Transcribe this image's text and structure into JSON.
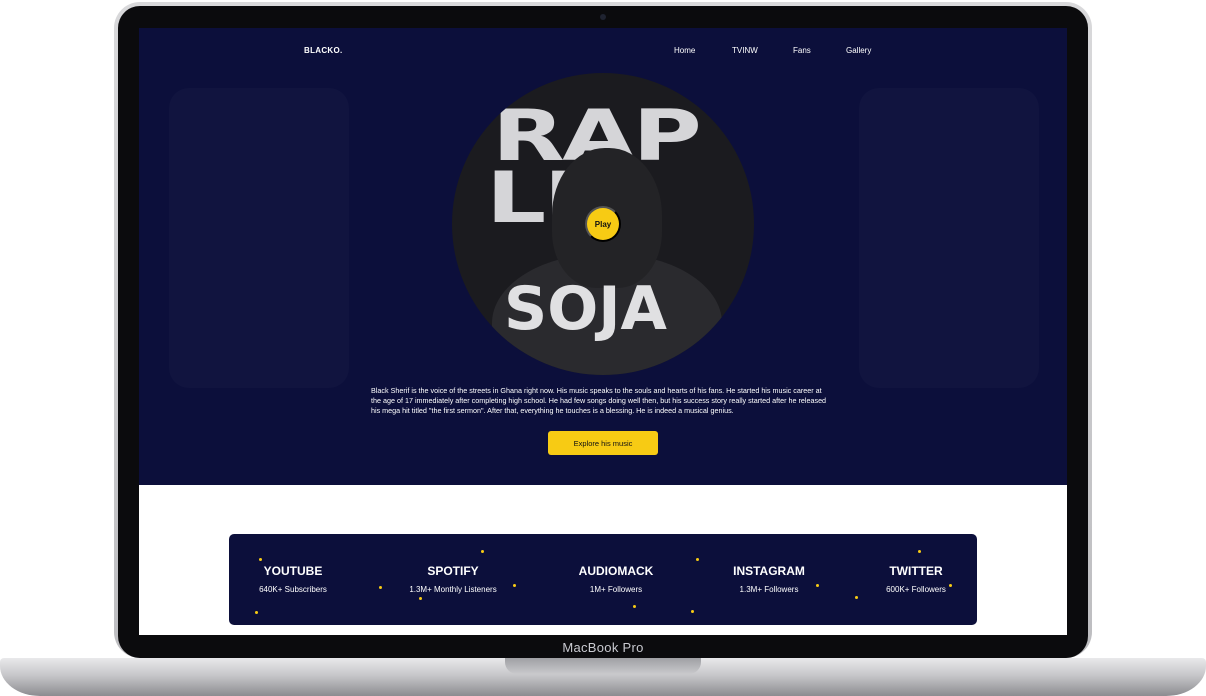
{
  "device": {
    "label": "MacBook Pro"
  },
  "nav": {
    "logo": "BLACKO.",
    "links": [
      "Home",
      "TVINW",
      "Fans",
      "Gallery"
    ]
  },
  "hero": {
    "cover_text": {
      "line1": "RAP",
      "line2": "LIE",
      "line3": "SOJA"
    },
    "play_label": "Play",
    "bio": "Black Sherif is the voice of the streets in Ghana right now. His music speaks to the souls and hearts of his fans. He started his music career at the age of 17 immediately after completing high school. He had few songs doing well then, but his success story really started after he released his mega hit titled \"the first sermon\". After that, everything he touches is a blessing. He is indeed a musical genius.",
    "cta_label": "Explore his music"
  },
  "stats": [
    {
      "name": "YOUTUBE",
      "value": "640K+ Subscribers"
    },
    {
      "name": "SPOTIFY",
      "value": "1.3M+ Monthly Listeners"
    },
    {
      "name": "AUDIOMACK",
      "value": "1M+ Followers"
    },
    {
      "name": "INSTAGRAM",
      "value": "1.3M+ Followers"
    },
    {
      "name": "TWITTER",
      "value": "600K+ Followers"
    }
  ],
  "colors": {
    "navy": "#0c0f3b",
    "accent": "#f7cb14",
    "white": "#ffffff"
  }
}
